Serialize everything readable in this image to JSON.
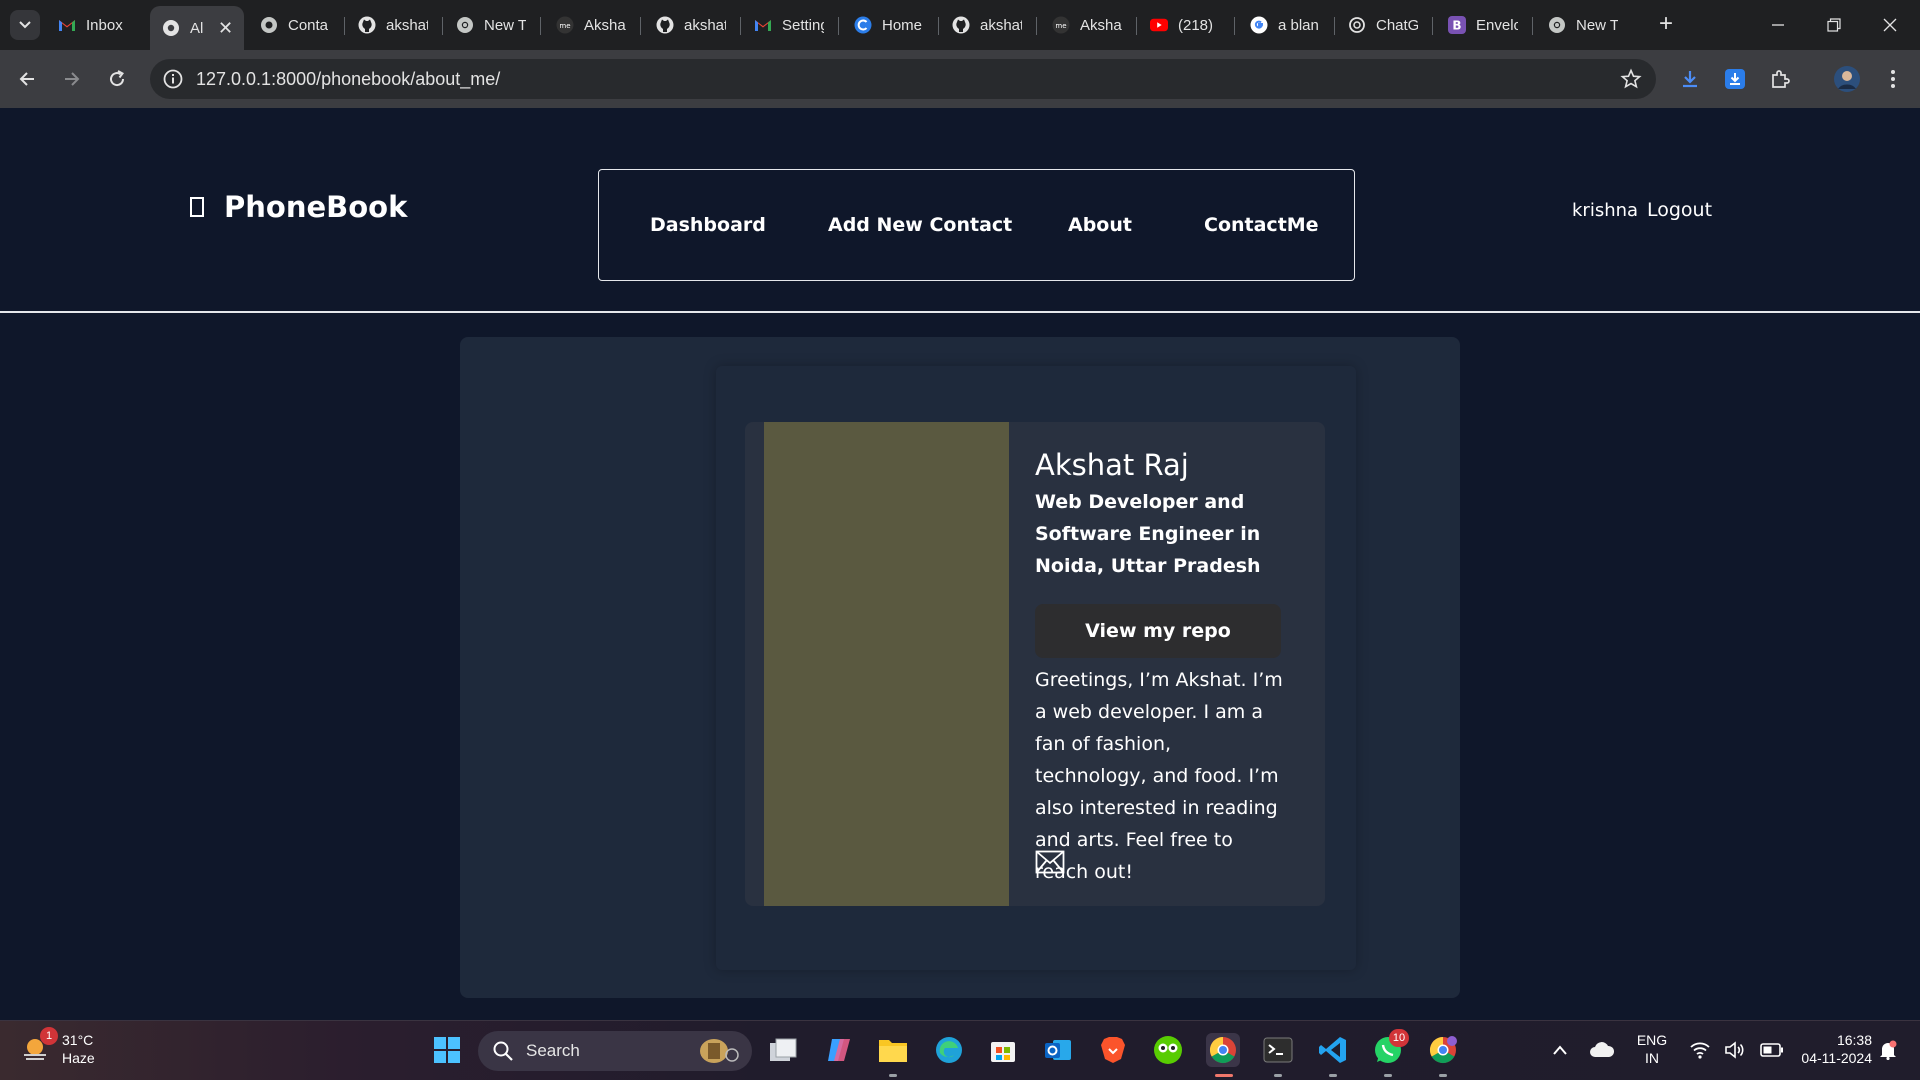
{
  "browser": {
    "tabs": [
      {
        "title": "Inbox",
        "icon": "gmail-icon",
        "active": false
      },
      {
        "title": "Al",
        "icon": "chrome-page-icon",
        "active": true
      },
      {
        "title": "Conta",
        "icon": "globe-icon",
        "active": false
      },
      {
        "title": "akshat",
        "icon": "github-icon",
        "active": false
      },
      {
        "title": "New T",
        "icon": "chrome-icon",
        "active": false
      },
      {
        "title": "Aksha",
        "icon": "about-me-icon",
        "active": false
      },
      {
        "title": "akshat",
        "icon": "github-icon",
        "active": false
      },
      {
        "title": "Setting",
        "icon": "gmail-icon",
        "active": false
      },
      {
        "title": "Home",
        "icon": "copilot-c-icon",
        "active": false
      },
      {
        "title": "akshat",
        "icon": "github-icon",
        "active": false
      },
      {
        "title": "Aksha",
        "icon": "about-me-icon",
        "active": false
      },
      {
        "title": "(218)",
        "icon": "youtube-icon",
        "active": false
      },
      {
        "title": "a blan",
        "icon": "google-icon",
        "active": false
      },
      {
        "title": "ChatG",
        "icon": "chatgpt-icon",
        "active": false
      },
      {
        "title": "Envelo",
        "icon": "bootstrap-icon",
        "active": false
      },
      {
        "title": "New T",
        "icon": "chrome-icon",
        "active": false
      }
    ],
    "url": "127.0.0.1:8000/phonebook/about_me/"
  },
  "site": {
    "brand": "PhoneBook",
    "nav": [
      "Dashboard",
      "Add New Contact",
      "About",
      "ContactMe"
    ],
    "user": "krishna",
    "logout": "Logout"
  },
  "profile": {
    "name": "Akshat Raj",
    "role": "Web Developer and Software Engineer in Noida, Uttar Pradesh",
    "button": "View my repo",
    "bio": "Greetings, I’m Akshat. I’m a web developer. I am a fan of fashion, technology, and food. I’m also interested in reading and arts. Feel free to reach out!",
    "photo_color": "#5a5940"
  },
  "taskbar": {
    "weather_temp": "31°C",
    "weather_desc": "Haze",
    "weather_badge": "1",
    "search": "Search",
    "whatsapp_badge": "10",
    "lang": "ENG",
    "region": "IN",
    "time": "16:38",
    "date": "04-11-2024"
  },
  "colors": {
    "page_bg": "#0f172a",
    "panel_bg": "#1e293b",
    "card_bg": "#293140",
    "button_bg": "#2d2d2f"
  }
}
